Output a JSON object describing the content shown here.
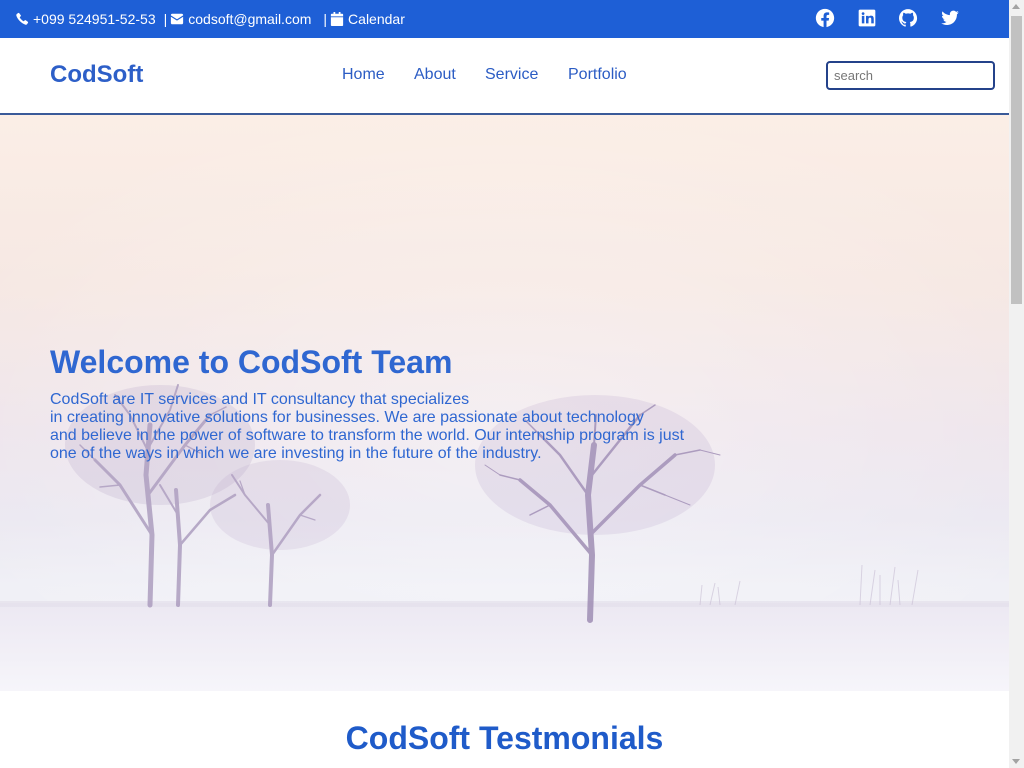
{
  "topbar": {
    "phone": "+099 524951-52-53",
    "separator": "|",
    "email": "codsoft@gmail.com",
    "calendar": "Calendar",
    "icons": [
      "phone-icon",
      "envelope-icon",
      "calendar-icon"
    ],
    "social": [
      "facebook-icon",
      "linkedin-icon",
      "github-icon",
      "twitter-icon"
    ],
    "background": "#1e5fd6"
  },
  "header": {
    "logo": "CodSoft",
    "nav": [
      "Home",
      "About",
      "Service",
      "Portfolio"
    ],
    "search_placeholder": "search"
  },
  "hero": {
    "title": "Welcome to CodSoft Team",
    "description_lines": [
      "CodSoft are IT services and IT consultancy that specializes",
      "in creating innovative solutions for businesses. We are passionate about technology",
      "and believe in the power of software to transform the world. Our internship program is just",
      "one of the ways in which we are investing in the future of the industry."
    ]
  },
  "testimonials": {
    "title": "CodSoft Testmonials"
  },
  "colors": {
    "brand": "#2d5fc8",
    "text_blue": "#2f67d1",
    "header_border": "#3a5a99"
  }
}
